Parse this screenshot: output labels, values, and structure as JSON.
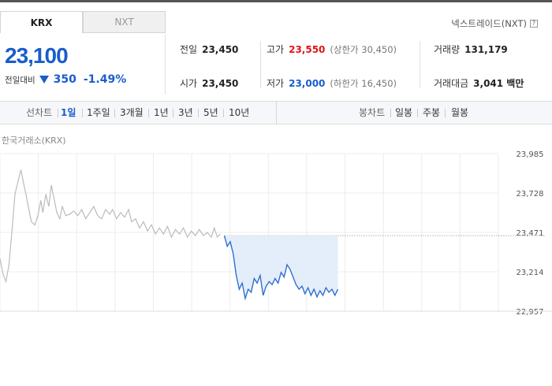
{
  "tabs": [
    {
      "label": "KRX",
      "active": true
    },
    {
      "label": "NXT",
      "active": false
    }
  ],
  "nxt_link": "넥스트레이드(NXT)",
  "help_glyph": "?",
  "price": {
    "current": "23,100",
    "change_label": "전일대비",
    "change": "350",
    "change_pct": "-1.49%",
    "direction": "down",
    "down_color": "#1a5dcc",
    "up_color": "#e01515"
  },
  "stats": {
    "prev_close": {
      "label": "전일",
      "value": "23,450"
    },
    "high": {
      "label": "고가",
      "value": "23,550",
      "sub": "(상한가 30,450)"
    },
    "volume": {
      "label": "거래량",
      "value": "131,179"
    },
    "open": {
      "label": "시가",
      "value": "23,450"
    },
    "low": {
      "label": "저가",
      "value": "23,000",
      "sub": "(하한가 16,450)"
    },
    "turnover": {
      "label": "거래대금",
      "value": "3,041 백만"
    }
  },
  "periods": {
    "label": "선차트",
    "items": [
      "1일",
      "1주일",
      "3개월",
      "1년",
      "3년",
      "5년",
      "10년"
    ],
    "active": "1일"
  },
  "candles": {
    "label": "봉차트",
    "items": [
      "일봉",
      "주봉",
      "월봉"
    ]
  },
  "source_label": "한국거래소(KRX)",
  "chart_data": {
    "type": "line",
    "y_ticks": [
      "23,985",
      "23,728",
      "23,471",
      "23,214",
      "22,957"
    ],
    "ylim": [
      22957,
      23985
    ],
    "reference_price": 23450,
    "x_range": [
      0,
      100
    ],
    "series": [
      {
        "history_color": "#bbbbbb",
        "today_color": "#2f6fd0",
        "points": [
          [
            0,
            23300
          ],
          [
            0.6,
            23200
          ],
          [
            1.2,
            23150
          ],
          [
            1.8,
            23260
          ],
          [
            2.4,
            23480
          ],
          [
            3.0,
            23720
          ],
          [
            3.6,
            23800
          ],
          [
            4.2,
            23880
          ],
          [
            4.8,
            23780
          ],
          [
            5.2,
            23720
          ],
          [
            5.8,
            23620
          ],
          [
            6.3,
            23540
          ],
          [
            7.0,
            23520
          ],
          [
            7.6,
            23580
          ],
          [
            8.2,
            23680
          ],
          [
            8.6,
            23600
          ],
          [
            9.2,
            23720
          ],
          [
            9.8,
            23640
          ],
          [
            10.3,
            23780
          ],
          [
            10.8,
            23700
          ],
          [
            11.4,
            23600
          ],
          [
            12.0,
            23560
          ],
          [
            12.5,
            23640
          ],
          [
            13.2,
            23580
          ],
          [
            14.0,
            23590
          ],
          [
            14.8,
            23610
          ],
          [
            15.6,
            23580
          ],
          [
            16.4,
            23620
          ],
          [
            17.2,
            23560
          ],
          [
            18.0,
            23600
          ],
          [
            18.8,
            23640
          ],
          [
            19.6,
            23580
          ],
          [
            20.4,
            23560
          ],
          [
            21.2,
            23620
          ],
          [
            22.0,
            23590
          ],
          [
            22.6,
            23620
          ],
          [
            23.4,
            23560
          ],
          [
            24.2,
            23600
          ],
          [
            25.0,
            23570
          ],
          [
            25.8,
            23620
          ],
          [
            26.4,
            23540
          ],
          [
            27.2,
            23560
          ],
          [
            28.0,
            23500
          ],
          [
            28.8,
            23540
          ],
          [
            29.6,
            23480
          ],
          [
            30.4,
            23520
          ],
          [
            31.2,
            23460
          ],
          [
            32.0,
            23500
          ],
          [
            32.8,
            23460
          ],
          [
            33.6,
            23510
          ],
          [
            34.4,
            23440
          ],
          [
            35.2,
            23490
          ],
          [
            36.0,
            23460
          ],
          [
            36.8,
            23500
          ],
          [
            37.6,
            23440
          ],
          [
            38.4,
            23480
          ],
          [
            39.2,
            23450
          ],
          [
            40.0,
            23490
          ],
          [
            40.8,
            23450
          ],
          [
            41.6,
            23470
          ],
          [
            42.4,
            23440
          ],
          [
            43.0,
            23500
          ],
          [
            43.6,
            23440
          ],
          [
            44.2,
            23460
          ]
        ],
        "today_points": [
          [
            45.0,
            23450
          ],
          [
            45.6,
            23380
          ],
          [
            46.2,
            23410
          ],
          [
            46.8,
            23330
          ],
          [
            47.4,
            23190
          ],
          [
            48.0,
            23100
          ],
          [
            48.6,
            23140
          ],
          [
            49.2,
            23040
          ],
          [
            49.8,
            23100
          ],
          [
            50.4,
            23080
          ],
          [
            51.0,
            23170
          ],
          [
            51.6,
            23140
          ],
          [
            52.2,
            23190
          ],
          [
            52.8,
            23060
          ],
          [
            53.4,
            23120
          ],
          [
            54.0,
            23150
          ],
          [
            54.6,
            23130
          ],
          [
            55.2,
            23170
          ],
          [
            55.8,
            23140
          ],
          [
            56.4,
            23210
          ],
          [
            57.0,
            23180
          ],
          [
            57.6,
            23260
          ],
          [
            58.2,
            23230
          ],
          [
            58.8,
            23180
          ],
          [
            59.4,
            23130
          ],
          [
            60.0,
            23100
          ],
          [
            60.6,
            23120
          ],
          [
            61.2,
            23070
          ],
          [
            61.8,
            23110
          ],
          [
            62.4,
            23060
          ],
          [
            63.0,
            23100
          ],
          [
            63.6,
            23050
          ],
          [
            64.2,
            23090
          ],
          [
            64.8,
            23060
          ],
          [
            65.4,
            23110
          ],
          [
            66.0,
            23080
          ],
          [
            66.6,
            23100
          ],
          [
            67.2,
            23060
          ],
          [
            67.8,
            23100
          ]
        ]
      }
    ],
    "grid": true
  }
}
